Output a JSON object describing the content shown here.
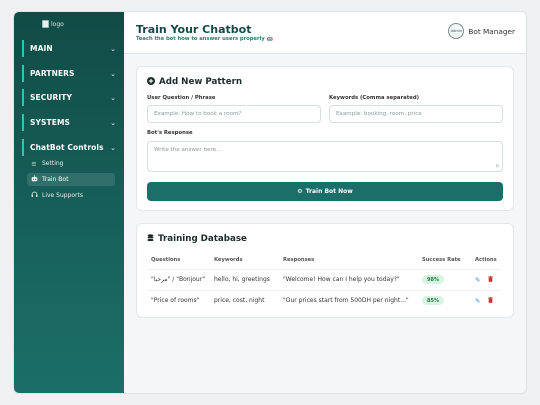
{
  "sidebar": {
    "logo_alt": "logo",
    "groups": [
      {
        "label": "MAIN"
      },
      {
        "label": "PARTNERS"
      },
      {
        "label": "SECURITY"
      },
      {
        "label": "SYSTEMS"
      },
      {
        "label": "ChatBot Controls"
      }
    ],
    "sub_items": [
      {
        "label": "Setting",
        "icon": "sliders-icon"
      },
      {
        "label": "Train Bot",
        "icon": "robot-icon"
      },
      {
        "label": "Live Supports",
        "icon": "headset-icon"
      }
    ]
  },
  "header": {
    "title": "Train Your Chatbot",
    "subtitle": "Teach the bot how to answer users properly 🤖",
    "profile_name": "Bot Manager",
    "avatar_text": "Admin"
  },
  "add_pattern": {
    "title": "Add New Pattern",
    "question_label": "User Question / Phrase",
    "question_placeholder": "Example: How to book a room?",
    "keywords_label": "Keywords (Comma separated)",
    "keywords_placeholder": "Example: booking, room, price",
    "response_label": "Bot's Response",
    "response_placeholder": "Write the answer here...",
    "button_label": "Train Bot Now"
  },
  "database": {
    "title": "Training Database",
    "columns": [
      "Questions",
      "Keywords",
      "Responses",
      "Success Rate",
      "Actions"
    ],
    "rows": [
      {
        "question": "\"مرحبا\" / \"Bonjour\"",
        "keywords": "hello, hi, greetings",
        "response": "\"Welcome! How can I help you today?\"",
        "rate": "98%"
      },
      {
        "question": "\"Price of rooms\"",
        "keywords": "price, cost, night",
        "response": "\"Our prices start from 500DH per night...\"",
        "rate": "85%"
      }
    ]
  },
  "colors": {
    "brand": "#124b46",
    "accent": "#1b6f68",
    "sidebar_border": "#35c2b0",
    "success_bg": "#d9f4e2",
    "edit": "#2b8bd6",
    "delete": "#d22f2f"
  }
}
